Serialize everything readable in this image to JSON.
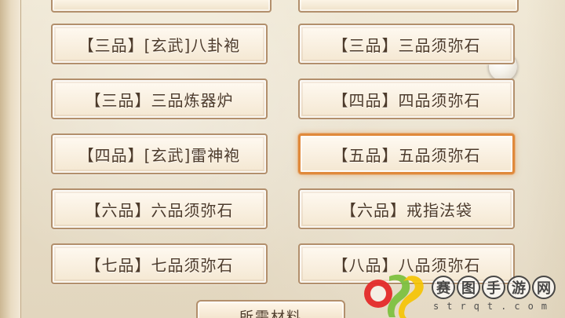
{
  "items": [
    {
      "label": "【三品】[玄武]八卦袍"
    },
    {
      "label": "【三品】三品须弥石"
    },
    {
      "label": "【三品】三品炼器炉"
    },
    {
      "label": "【四品】四品须弥石"
    },
    {
      "label": "【四品】[玄武]雷神袍"
    },
    {
      "label": "【五品】五品须弥石"
    },
    {
      "label": "【六品】六品须弥石"
    },
    {
      "label": "【六品】戒指法袋"
    },
    {
      "label": "【七品】七品须弥石"
    },
    {
      "label": "【八品】八品须弥石"
    }
  ],
  "materials_tab": {
    "label": "所需材料"
  },
  "watermark": {
    "chars": [
      "赛",
      "图",
      "手",
      "游",
      "网"
    ],
    "domain": "strqt.com"
  },
  "colors": {
    "button_border": "#b28f6c",
    "selected_border": "#e0893b",
    "text": "#4d3b2b"
  }
}
